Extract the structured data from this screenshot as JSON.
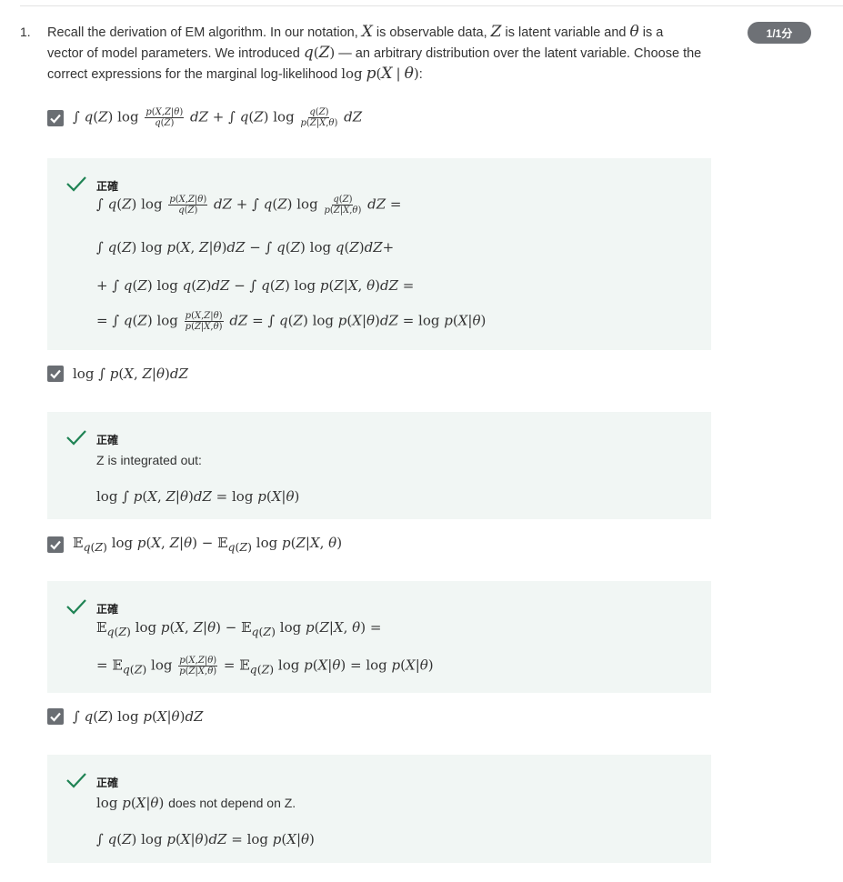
{
  "question": {
    "number": "1.",
    "score": "1/1分",
    "text": "Recall the derivation of EM algorithm. In our notation, X is observable data, Z is latent variable and θ is a vector of model parameters. We introduced q(Z) — an arbitrary distribution over the latent variable. Choose the correct expressions for the marginal log-likelihood log p(X | θ):"
  },
  "options": [
    {
      "expression": "∫ q(Z) log [p(X,Z|θ) / q(Z)] dZ + ∫ q(Z) log [q(Z) / p(Z|X,θ)] dZ",
      "checked": true,
      "feedback": {
        "label": "正確",
        "lines": [
          "∫ q(Z) log [p(X,Z|θ) / q(Z)] dZ + ∫ q(Z) log [q(Z) / p(Z|X,θ)] dZ =",
          "∫ q(Z) log p(X, Z|θ)dZ − ∫ q(Z) log q(Z)dZ+",
          "+ ∫ q(Z) log q(Z)dZ − ∫ q(Z) log p(Z|X, θ)dZ =",
          "= ∫ q(Z) log [p(X,Z|θ) / p(Z|X,θ)] dZ = ∫ q(Z) log p(X|θ)dZ = log p(X|θ)"
        ]
      }
    },
    {
      "expression": "log ∫ p(X, Z|θ)dZ",
      "checked": true,
      "feedback": {
        "label": "正確",
        "text": "Z is integrated out:",
        "lines": [
          "log ∫ p(X, Z|θ)dZ = log p(X|θ)"
        ]
      }
    },
    {
      "expression": "E_q(Z) log p(X, Z|θ) − E_q(Z) log p(Z|X, θ)",
      "checked": true,
      "feedback": {
        "label": "正確",
        "lines": [
          "E_q(Z) log p(X, Z|θ) − E_q(Z) log p(Z|X, θ) =",
          "= E_q(Z) log [p(X,Z|θ) / p(Z|X,θ)] = E_q(Z) log p(X|θ) = log p(X|θ)"
        ]
      }
    },
    {
      "expression": "∫ q(Z) log p(X|θ)dZ",
      "checked": true,
      "feedback": {
        "label": "正確",
        "text": "log p(X|θ) does not depend on Z.",
        "lines": [
          "∫ q(Z) log p(X|θ)dZ = log p(X|θ)"
        ]
      }
    }
  ],
  "colors": {
    "check_green": "#1f8354",
    "feedback_bg": "#f1f6f4",
    "checkbox_gray": "#6a6e73",
    "badge_gray": "#6e7176"
  },
  "icons": [
    "checkbox-checked-icon",
    "correct-check-icon"
  ]
}
